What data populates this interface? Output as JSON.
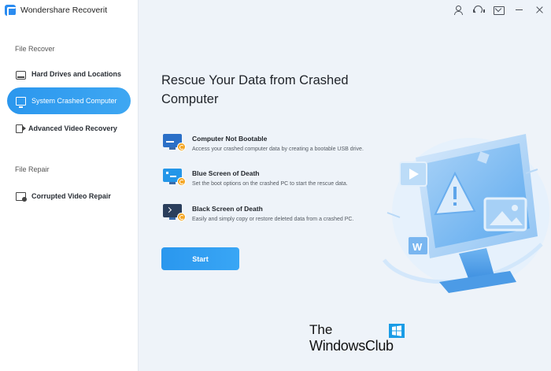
{
  "app": {
    "title": "Wondershare Recoverit"
  },
  "sidebar": {
    "sections": [
      {
        "label": "File Recover"
      },
      {
        "label": "File Repair"
      }
    ],
    "items": [
      {
        "label": "Hard Drives and Locations",
        "icon": "hard-drive-icon",
        "active": false
      },
      {
        "label": "System Crashed Computer",
        "icon": "monitor-icon",
        "active": true
      },
      {
        "label": "Advanced Video Recovery",
        "icon": "video-icon",
        "active": false
      },
      {
        "label": "Corrupted Video Repair",
        "icon": "video-repair-icon",
        "active": false
      }
    ]
  },
  "toolbar": {
    "icons": [
      "user-icon",
      "support-headset-icon",
      "mail-icon",
      "minimize-icon",
      "close-icon"
    ]
  },
  "main": {
    "title": "Rescue Your Data from Crashed Computer",
    "options": [
      {
        "title": "Computer Not Bootable",
        "desc": "Access your crashed computer data by creating a bootable USB drive.",
        "icon": "computer-not-bootable-icon"
      },
      {
        "title": "Blue Screen of Death",
        "desc": "Set the boot options on the crashed PC to start the rescue data.",
        "icon": "blue-screen-icon"
      },
      {
        "title": "Black Screen of Death",
        "desc": "Easily and simply copy or restore deleted data from a crashed PC.",
        "icon": "black-screen-icon"
      }
    ],
    "start_label": "Start"
  },
  "watermark": {
    "line1": "The",
    "line2": "WindowsClub"
  },
  "colors": {
    "accent": "#2b9af0",
    "sidebar_bg": "#ffffff",
    "main_bg": "#eef3f9"
  }
}
